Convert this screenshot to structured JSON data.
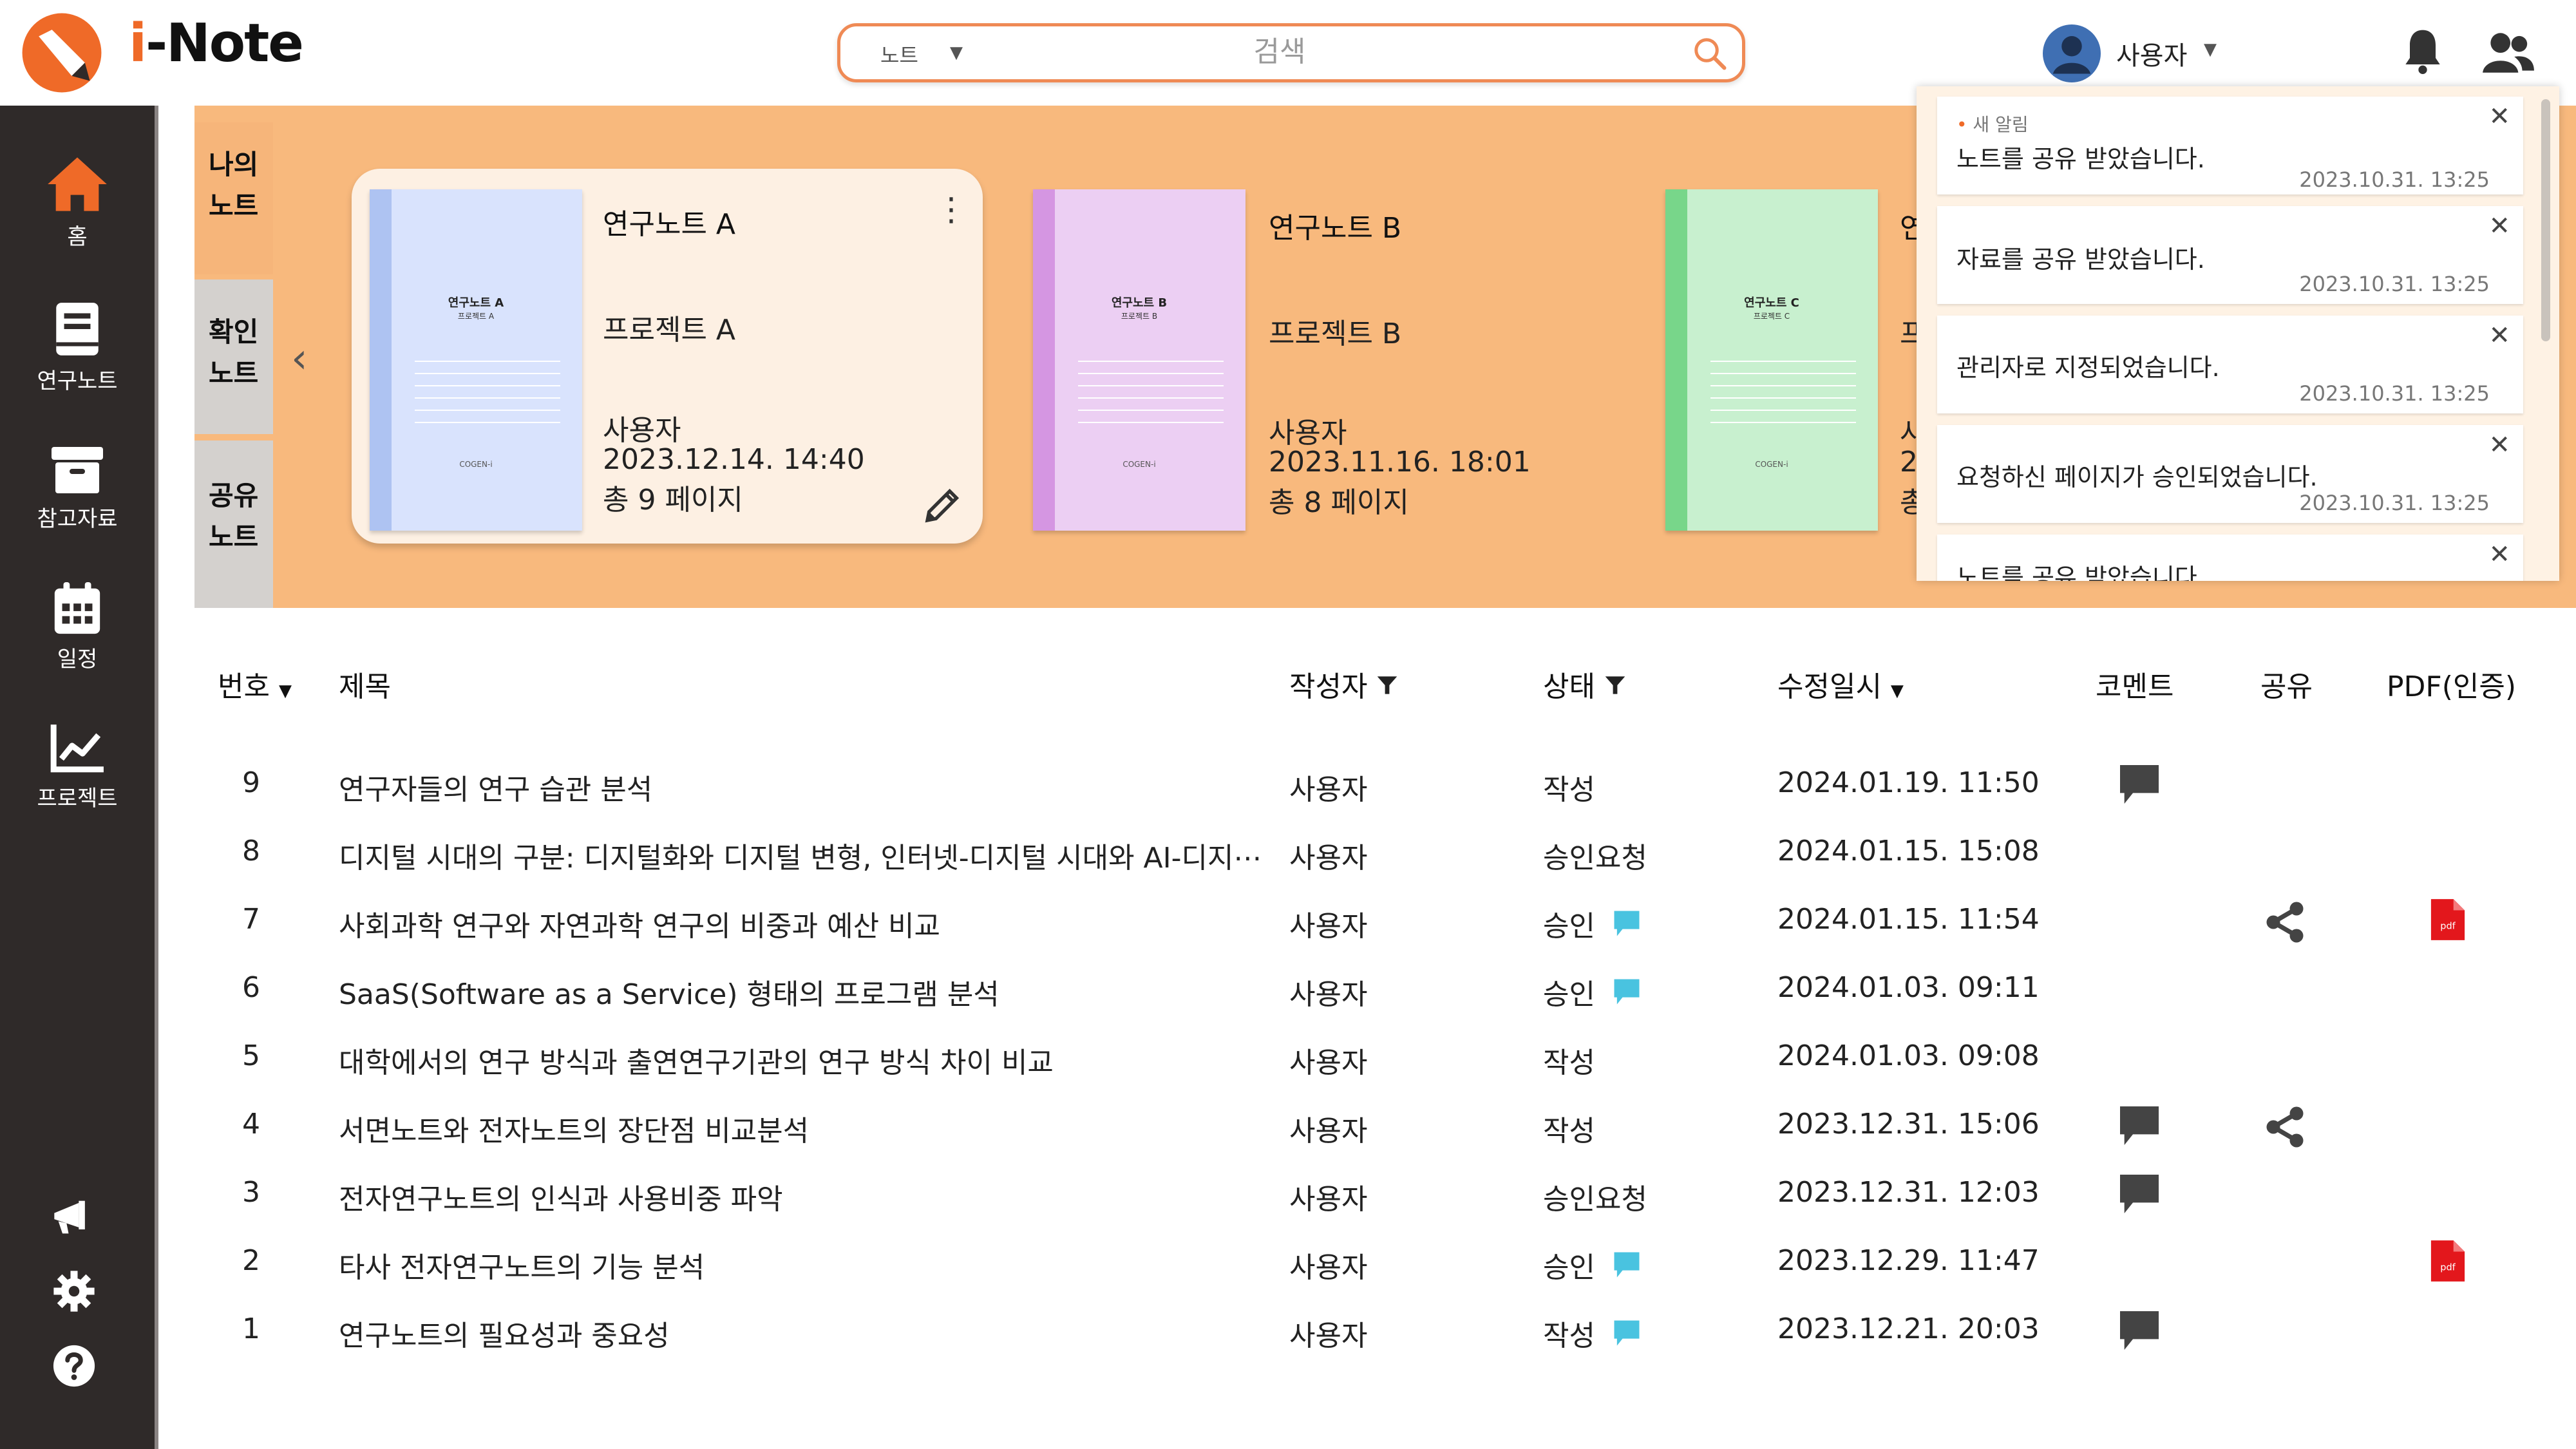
{
  "app": {
    "title_accent": "i",
    "title_rest": "-Note"
  },
  "search": {
    "scope": "노트",
    "placeholder": "검색"
  },
  "user": {
    "name": "사용자"
  },
  "sidebar": {
    "items": [
      {
        "label": "홈",
        "icon": "home-icon"
      },
      {
        "label": "연구노트",
        "icon": "notebook-icon"
      },
      {
        "label": "참고자료",
        "icon": "archive-icon"
      },
      {
        "label": "일정",
        "icon": "calendar-icon"
      },
      {
        "label": "프로젝트",
        "icon": "chart-icon"
      }
    ],
    "bottom_icons": [
      "megaphone-icon",
      "gear-icon",
      "help-icon"
    ]
  },
  "tabs": [
    {
      "line1": "나의",
      "line2": "노트"
    },
    {
      "line1": "확인",
      "line2": "노트"
    },
    {
      "line1": "공유",
      "line2": "노트"
    }
  ],
  "notebooks": [
    {
      "title": "연구노트 A",
      "project": "프로젝트 A",
      "user": "사용자",
      "date": "2023.12.14.  14:40",
      "pages": "총 9 페이지",
      "cover_title": "연구노트 A",
      "cover_sub": "프로젝트 A",
      "cover_foot": "COGEN-i"
    },
    {
      "title": "연구노트 B",
      "project": "프로젝트 B",
      "user": "사용자",
      "date": "2023.11.16.  18:01",
      "pages": "총 8 페이지",
      "cover_title": "연구노트 B",
      "cover_sub": "프로젝트 B",
      "cover_foot": "COGEN-i"
    },
    {
      "title": "연",
      "project": "프",
      "user": "사",
      "date": "2",
      "pages": "총",
      "cover_title": "연구노트 C",
      "cover_sub": "프로젝트 C",
      "cover_foot": "COGEN-i"
    }
  ],
  "notifications": [
    {
      "badge": "새 알림",
      "message": "노트를 공유 받았습니다.",
      "time": "2023.10.31.  13:25"
    },
    {
      "badge": "",
      "message": "자료를 공유 받았습니다.",
      "time": "2023.10.31.  13:25"
    },
    {
      "badge": "",
      "message": "관리자로 지정되었습니다.",
      "time": "2023.10.31.  13:25"
    },
    {
      "badge": "",
      "message": "요청하신 페이지가 승인되었습니다.",
      "time": "2023.10.31.  13:25"
    },
    {
      "badge": "",
      "message": "노트를 공유 받았습니다",
      "time": ""
    }
  ],
  "table": {
    "headers": {
      "number": "번호",
      "title": "제목",
      "author": "작성자",
      "status": "상태",
      "modified": "수정일시",
      "comment": "코멘트",
      "share": "공유",
      "pdf": "PDF(인증)"
    },
    "rows": [
      {
        "no": "9",
        "title": "연구자들의 연구 습관 분석",
        "author": "사용자",
        "status": "작성",
        "chip": false,
        "date": "2024.01.19. 11:50",
        "comment": true,
        "share": false,
        "pdf": false
      },
      {
        "no": "8",
        "title": "디지털 시대의 구분: 디지털화와 디지털 변형, 인터넷-디지털 시대와 AI-디지⋯",
        "author": "사용자",
        "status": "승인요청",
        "chip": false,
        "date": "2024.01.15. 15:08",
        "comment": false,
        "share": false,
        "pdf": false
      },
      {
        "no": "7",
        "title": "사회과학 연구와 자연과학 연구의 비중과 예산 비교",
        "author": "사용자",
        "status": "승인",
        "chip": true,
        "date": "2024.01.15. 11:54",
        "comment": false,
        "share": true,
        "pdf": true
      },
      {
        "no": "6",
        "title": "SaaS(Software as a Service) 형태의 프로그램 분석",
        "author": "사용자",
        "status": "승인",
        "chip": true,
        "date": "2024.01.03. 09:11",
        "comment": false,
        "share": false,
        "pdf": false
      },
      {
        "no": "5",
        "title": "대학에서의 연구 방식과 출연연구기관의 연구 방식 차이 비교",
        "author": "사용자",
        "status": "작성",
        "chip": false,
        "date": "2024.01.03. 09:08",
        "comment": false,
        "share": false,
        "pdf": false
      },
      {
        "no": "4",
        "title": "서면노트와 전자노트의 장단점 비교분석",
        "author": "사용자",
        "status": "작성",
        "chip": false,
        "date": "2023.12.31. 15:06",
        "comment": true,
        "share": true,
        "pdf": false
      },
      {
        "no": "3",
        "title": "전자연구노트의 인식과 사용비중 파악",
        "author": "사용자",
        "status": "승인요청",
        "chip": false,
        "date": "2023.12.31. 12:03",
        "comment": true,
        "share": false,
        "pdf": false
      },
      {
        "no": "2",
        "title": "타사 전자연구노트의 기능 분석",
        "author": "사용자",
        "status": "승인",
        "chip": true,
        "date": "2023.12.29. 11:47",
        "comment": false,
        "share": false,
        "pdf": true
      },
      {
        "no": "1",
        "title": "연구노트의 필요성과 중요성",
        "author": "사용자",
        "status": "작성",
        "chip": true,
        "date": "2023.12.21. 20:03",
        "comment": true,
        "share": false,
        "pdf": false
      }
    ]
  },
  "pdf_icon_label": "pdf",
  "colors": {
    "accent": "#ef6a28",
    "sidebar": "#2f2a29",
    "banner": "#f8b97d",
    "chip": "#49c3e0",
    "pdf": "#e3171c"
  }
}
